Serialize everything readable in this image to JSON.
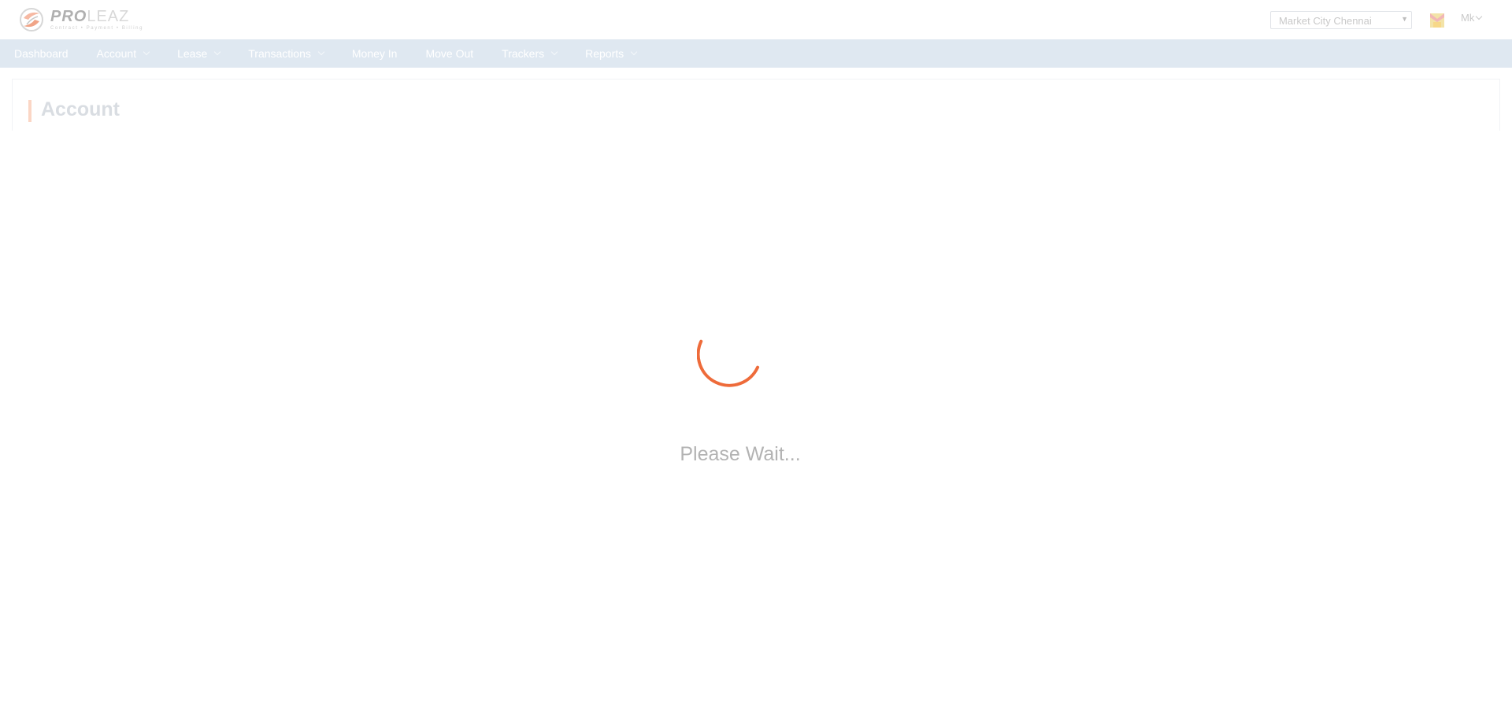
{
  "header": {
    "logo": {
      "brand_left": "PRO",
      "brand_right": "LEAZ",
      "tagline": "Contract • Payment • Billing",
      "icon": "prolease-logo-icon"
    },
    "property_selector": {
      "selected": "Market City Chennai",
      "icon": "dropdown-triangle-icon"
    },
    "avatar_icon": "user-avatar-icon",
    "user_menu": {
      "label": "Mk",
      "icon": "chevron-down-icon"
    }
  },
  "nav": {
    "items": [
      {
        "label": "Dashboard",
        "has_dropdown": false
      },
      {
        "label": "Account",
        "has_dropdown": true
      },
      {
        "label": "Lease",
        "has_dropdown": true
      },
      {
        "label": "Transactions",
        "has_dropdown": true
      },
      {
        "label": "Money In",
        "has_dropdown": false
      },
      {
        "label": "Move Out",
        "has_dropdown": false
      },
      {
        "label": "Trackers",
        "has_dropdown": true
      },
      {
        "label": "Reports",
        "has_dropdown": true
      }
    ]
  },
  "page": {
    "title": "Account"
  },
  "loader": {
    "text": "Please Wait...",
    "icon": "loading-spinner-icon",
    "color": "#ee6b3a"
  },
  "colors": {
    "accent": "#ee6b3a",
    "nav_bg": "#dfe8f1"
  }
}
